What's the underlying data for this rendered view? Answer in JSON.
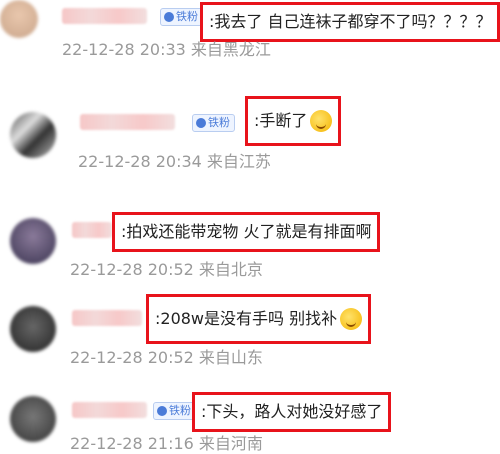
{
  "comments": [
    {
      "text": ":我去了 自己连袜子都穿不了吗？？？？",
      "time": "22-12-28 20:33",
      "location": "来自黑龙江",
      "badge": "铁粉",
      "emoji": false
    },
    {
      "text": ":手断了",
      "time": "22-12-28 20:34",
      "location": "来自江苏",
      "badge": "铁粉",
      "emoji": true
    },
    {
      "text": ":拍戏还能带宠物 火了就是有排面啊",
      "time": "22-12-28 20:52",
      "location": "来自北京",
      "badge": "",
      "emoji": false
    },
    {
      "text": ":208w是没有手吗 别找补",
      "time": "22-12-28 20:52",
      "location": "来自山东",
      "badge": "",
      "emoji": true
    },
    {
      "text": ":下头，路人对她没好感了",
      "time": "22-12-28 21:16",
      "location": "来自河南",
      "badge": "铁粉",
      "emoji": false
    }
  ],
  "colors": {
    "highlight": "#e8131b",
    "meta": "#9a9a9a",
    "badge": "#4a7bd8"
  },
  "icons": {
    "badge": "fan-badge-icon",
    "emoji": "emoji-icon"
  }
}
